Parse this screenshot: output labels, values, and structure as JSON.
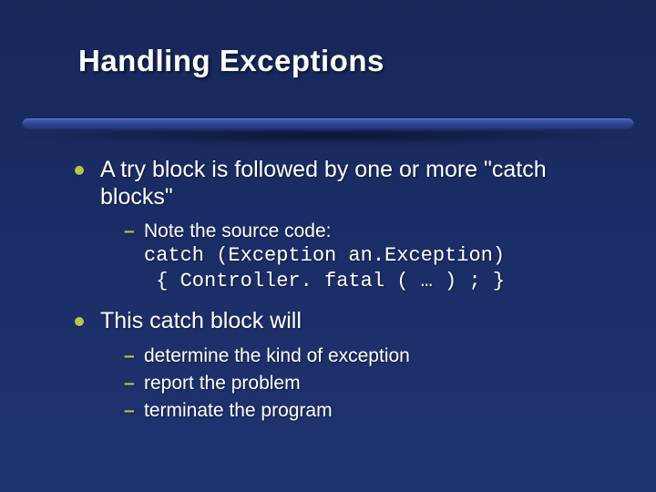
{
  "title": "Handling Exceptions",
  "bullets": [
    {
      "text": "A try block is followed by one or more \"catch blocks\"",
      "sub": [
        {
          "text": "Note the source code:",
          "code": "catch (Exception an.Exception)\n { Controller. fatal ( … ) ; }"
        }
      ]
    },
    {
      "text": "This catch block will",
      "sub": [
        {
          "text": "determine the kind of exception"
        },
        {
          "text": "report the problem"
        },
        {
          "text": "terminate the program"
        }
      ]
    }
  ]
}
